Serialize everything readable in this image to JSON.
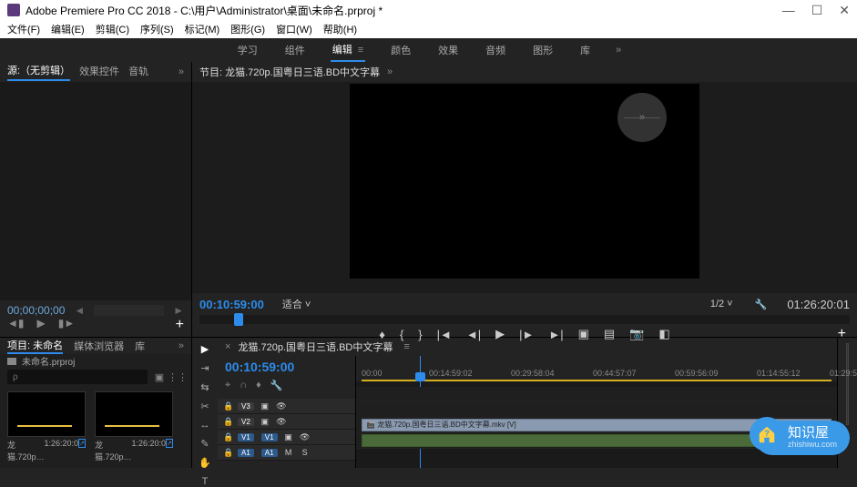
{
  "titlebar": {
    "app_name": "Adobe Premiere Pro CC 2018",
    "separator": " - ",
    "path": "C:\\用户\\Administrator\\桌面\\未命名.prproj *"
  },
  "menu": {
    "file": "文件(F)",
    "edit": "编辑(E)",
    "clip": "剪辑(C)",
    "sequence": "序列(S)",
    "markers": "标记(M)",
    "graphics": "图形(G)",
    "window": "窗口(W)",
    "help": "帮助(H)"
  },
  "workspaces": {
    "learn": "学习",
    "assembly": "组件",
    "editing": "编辑",
    "color": "颜色",
    "effects": "效果",
    "audio": "音频",
    "graphics": "图形",
    "library": "库"
  },
  "source_panel": {
    "tab_source": "源:（无剪辑）",
    "tab_effect": "效果控件",
    "tab_audio": "音轨",
    "timecode": "00;00;00;00"
  },
  "program_panel": {
    "title": "节目: 龙猫.720p.国粤日三语.BD中文字幕",
    "timecode_left": "00:10:59:00",
    "fit_label": "适合",
    "scale": "1/2",
    "timecode_right": "01:26:20:01"
  },
  "project_panel": {
    "tab_project": "项目: 未命名",
    "tab_media": "媒体浏览器",
    "tab_lib": "库",
    "breadcrumb": "未命名.prproj",
    "search_placeholder": "ρ",
    "clips": [
      {
        "name": "龙猫.720p…",
        "duration": "1:26:20:0"
      },
      {
        "name": "龙猫.720p…",
        "duration": "1:26:20:0"
      }
    ]
  },
  "timeline": {
    "sequence_name": "龙猫.720p.国粤日三语.BD中文字幕",
    "timecode": "00:10:59:00",
    "ruler_ticks": [
      "00:00",
      "00:14:59:02",
      "00:29:58:04",
      "00:44:57:07",
      "00:59:56:09",
      "01:14:55:12",
      "01:29:5"
    ],
    "tracks": {
      "v3": "V3",
      "v2": "V2",
      "v1": "V1",
      "a1": "A1"
    },
    "clip_label": "龙猫.720p.国粤日三语.BD中文字幕.mkv [V]"
  },
  "watermark": {
    "title": "知识屋",
    "url": "zhishiwu.com"
  }
}
